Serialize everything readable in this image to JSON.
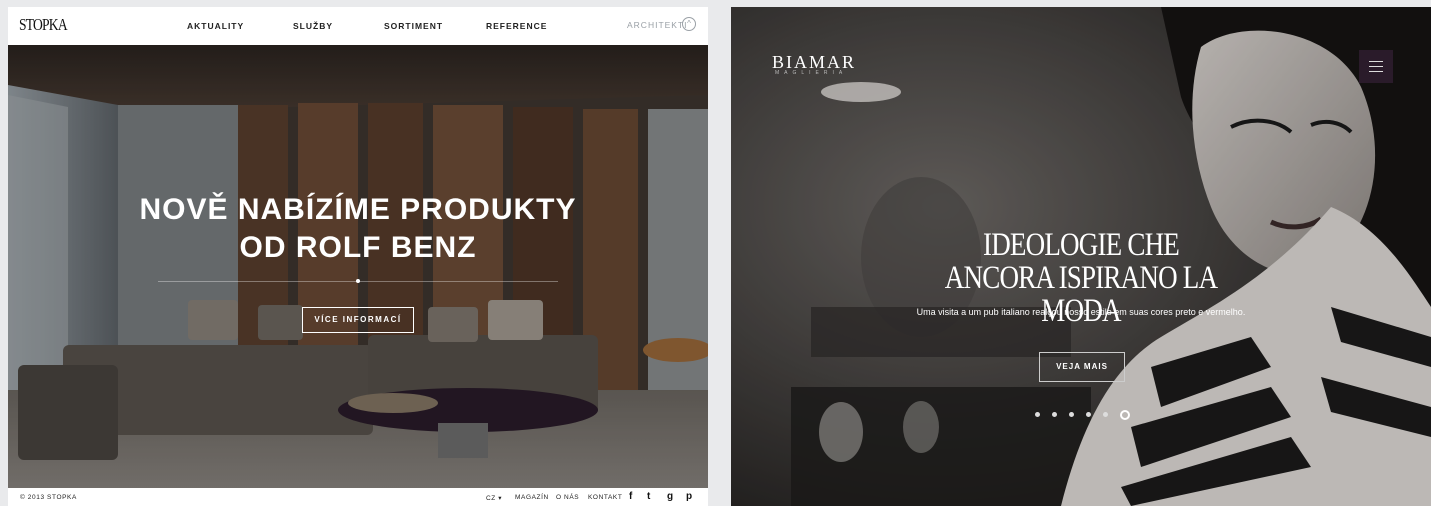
{
  "stopka": {
    "logo": "STOPKA",
    "nav": [
      "AKTUALITY",
      "SLUŽBY",
      "SORTIMENT",
      "REFERENCE"
    ],
    "architekti": "ARCHITEKTI",
    "architekti_icon": "chevron-up-circle-icon",
    "headline_line1": "NOVĚ NABÍZÍME PRODUKTY",
    "headline_line2": "OD ROLF BENZ",
    "cta": "VÍCE INFORMACÍ",
    "footer": {
      "copyright": "© 2013 STOPKA",
      "lang": "CZ ▾",
      "links": [
        "MAGAZÍN",
        "O NÁS",
        "KONTAKT"
      ],
      "social": [
        "facebook-icon",
        "twitter-icon",
        "google-plus-icon",
        "pinterest-icon"
      ],
      "social_glyphs": [
        "f",
        "t",
        "g",
        "p"
      ]
    }
  },
  "biamar": {
    "logo": "BIAMAR",
    "logo_sub": "MAGLIERIA",
    "menu_icon": "hamburger-menu-icon",
    "headline_line1": "IDEOLOGIE CHE",
    "headline_line2": "ANCORA ISPIRANO LA MODA",
    "subtitle": "Uma visita a um pub italiano realçou nosso estilo em suas cores preto e vermelho.",
    "cta": "VEJA MAIS",
    "slides": 6,
    "active_slide": 6
  }
}
